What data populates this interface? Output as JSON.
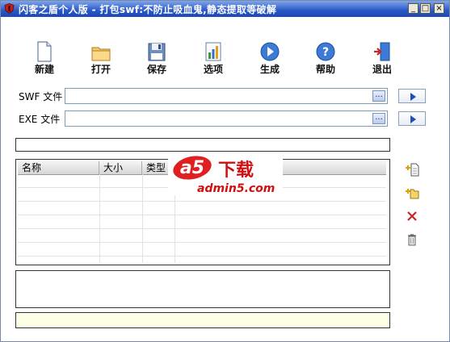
{
  "window": {
    "title": "闪客之盾个人版 - 打包swf:不防止吸血鬼,静态提取等破解",
    "minimize_glyph": "_",
    "maximize_glyph": "□",
    "close_glyph": "×"
  },
  "toolbar": {
    "items": [
      {
        "label": "新建",
        "icon": "new-file-icon"
      },
      {
        "label": "打开",
        "icon": "folder-open-icon"
      },
      {
        "label": "保存",
        "icon": "floppy-save-icon"
      },
      {
        "label": "选项",
        "icon": "options-chart-icon"
      },
      {
        "label": "生成",
        "icon": "play-generate-icon"
      },
      {
        "label": "帮助",
        "icon": "help-icon"
      },
      {
        "label": "退出",
        "icon": "exit-door-icon"
      }
    ]
  },
  "form": {
    "swf_label": "SWF 文件",
    "swf_value": "",
    "exe_label": "EXE 文件",
    "exe_value": "",
    "browse_glyph": "..."
  },
  "grid": {
    "columns": [
      "名称",
      "大小",
      "类型"
    ],
    "rows": []
  },
  "watermark": {
    "brand": "a5",
    "brand_cn": "下载",
    "url": "admin5.com"
  },
  "colors": {
    "titlebar": "#2a58c8",
    "status_bar": "#ffffe8",
    "accent_blue": "#1f4fb5",
    "delete_red": "#cc2222"
  }
}
